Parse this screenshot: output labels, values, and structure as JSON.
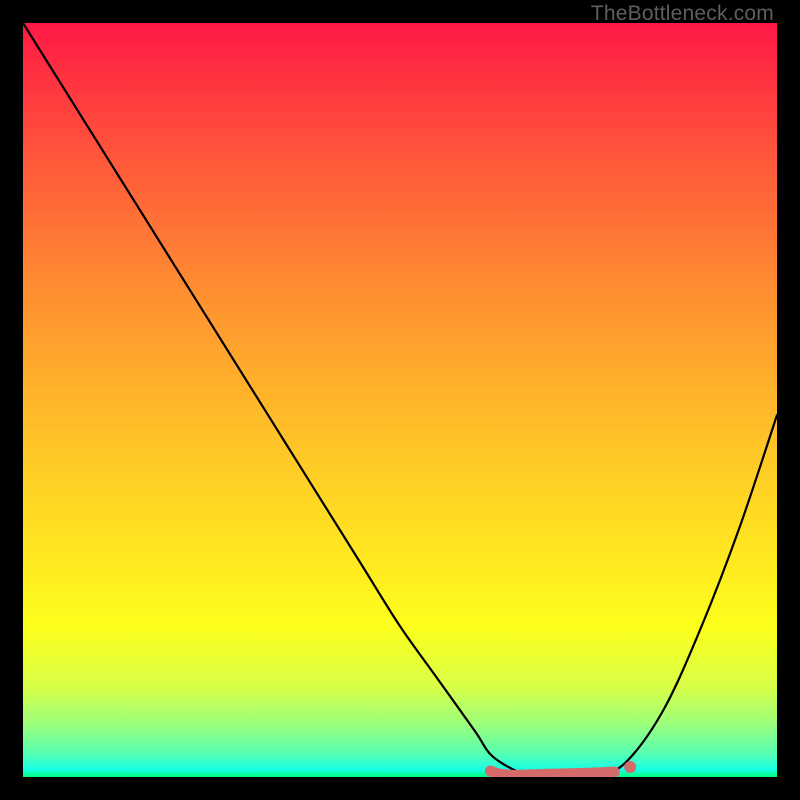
{
  "watermark": {
    "text": "TheBottleneck.com"
  },
  "colors": {
    "frame": "#000000",
    "curve": "#000000",
    "flat_marker": "#d46a6a",
    "flat_marker_end": "#d46a6a"
  },
  "chart_data": {
    "type": "line",
    "title": "",
    "xlabel": "",
    "ylabel": "",
    "xlim": [
      0,
      100
    ],
    "ylim": [
      0,
      100
    ],
    "grid": false,
    "x": [
      0,
      5,
      10,
      15,
      20,
      25,
      30,
      35,
      40,
      45,
      50,
      55,
      60,
      62,
      65,
      68,
      70,
      73,
      76,
      80,
      85,
      90,
      95,
      100
    ],
    "values": [
      100,
      92,
      84,
      76,
      68,
      60,
      52,
      44,
      36,
      28,
      20,
      13,
      6,
      3,
      1,
      0,
      0,
      0,
      0,
      2,
      9,
      20,
      33,
      48
    ],
    "flat_region": {
      "x_start": 62,
      "x_end": 80,
      "y": 0
    },
    "annotations": [
      {
        "text": "TheBottleneck.com",
        "position": "top-right"
      }
    ]
  }
}
